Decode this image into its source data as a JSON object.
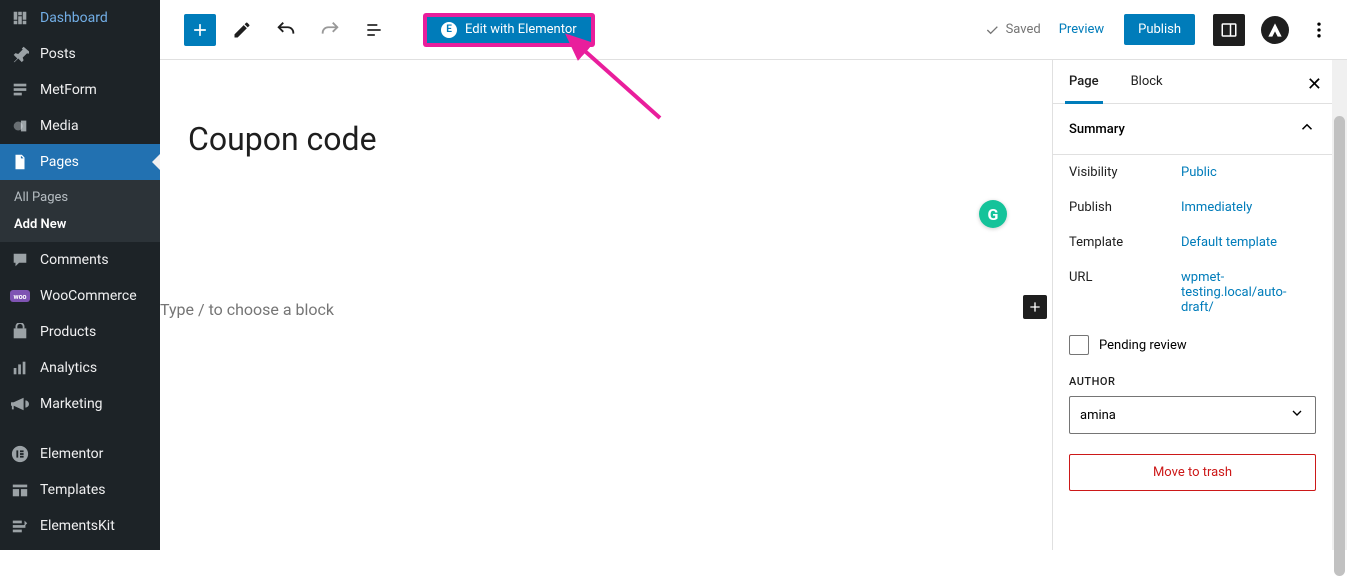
{
  "sidebar": {
    "items": [
      {
        "label": "Dashboard",
        "icon": "dashboard"
      },
      {
        "label": "Posts",
        "icon": "pin"
      },
      {
        "label": "MetForm",
        "icon": "form"
      },
      {
        "label": "Media",
        "icon": "media"
      },
      {
        "label": "Pages",
        "icon": "pages",
        "active": true
      },
      {
        "label": "Comments",
        "icon": "comment"
      },
      {
        "label": "WooCommerce",
        "icon": "woo"
      },
      {
        "label": "Products",
        "icon": "products"
      },
      {
        "label": "Analytics",
        "icon": "analytics"
      },
      {
        "label": "Marketing",
        "icon": "marketing"
      },
      {
        "label": "Elementor",
        "icon": "elementor"
      },
      {
        "label": "Templates",
        "icon": "templates"
      },
      {
        "label": "ElementsKit",
        "icon": "elementskit"
      }
    ],
    "pages_sub": {
      "all": "All Pages",
      "add": "Add New"
    }
  },
  "toolbar": {
    "elementor_label": "Edit with Elementor",
    "saved_label": "Saved",
    "preview_label": "Preview",
    "publish_label": "Publish"
  },
  "canvas": {
    "title": "Coupon code",
    "placeholder": "Type / to choose a block"
  },
  "panel": {
    "tabs": {
      "page": "Page",
      "block": "Block"
    },
    "summary_label": "Summary",
    "rows": {
      "visibility": {
        "label": "Visibility",
        "value": "Public"
      },
      "publish": {
        "label": "Publish",
        "value": "Immediately"
      },
      "template": {
        "label": "Template",
        "value": "Default template"
      },
      "url": {
        "label": "URL",
        "value": "wpmet-testing.local/auto-draft/"
      }
    },
    "pending_label": "Pending review",
    "author_heading": "AUTHOR",
    "author_value": "amina",
    "trash_label": "Move to trash"
  }
}
